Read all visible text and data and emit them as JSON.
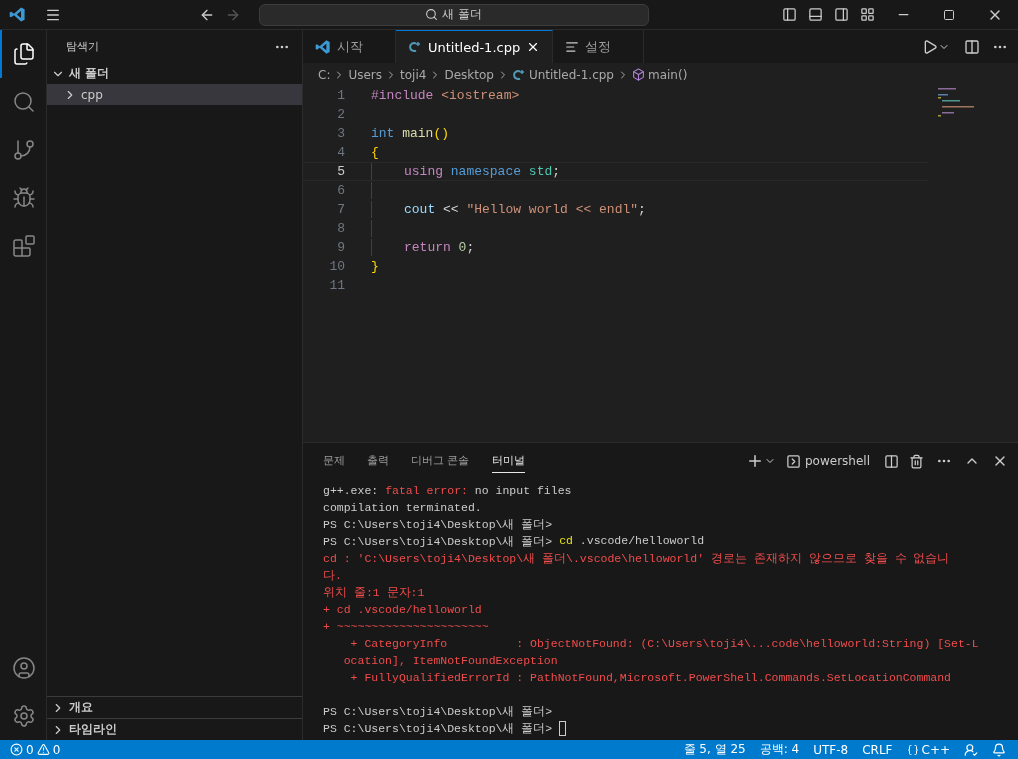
{
  "title_bar": {
    "search": "새 폴더"
  },
  "sidebar": {
    "title": "탐색기",
    "folder": {
      "label": "새 폴더",
      "expanded": true,
      "children": [
        {
          "label": "cpp",
          "expanded": false,
          "selected": true
        }
      ]
    },
    "sections": [
      {
        "label": "개요",
        "expanded": false
      },
      {
        "label": "타임라인",
        "expanded": false
      }
    ]
  },
  "tabs": [
    {
      "label": "시작",
      "kind": "welcome",
      "selected": false
    },
    {
      "label": "Untitled-1.cpp",
      "kind": "cpp",
      "selected": true
    },
    {
      "label": "설정",
      "kind": "settings",
      "selected": false
    }
  ],
  "breadcrumb": [
    {
      "label": "C:",
      "kind": "folder"
    },
    {
      "label": "Users",
      "kind": "folder"
    },
    {
      "label": "toji4",
      "kind": "folder"
    },
    {
      "label": "Desktop",
      "kind": "folder"
    },
    {
      "label": "Untitled-1.cpp",
      "kind": "file"
    },
    {
      "label": "main()",
      "kind": "symbol"
    }
  ],
  "editor": {
    "lines": [
      {
        "number": "1",
        "current": false,
        "indented": false,
        "tokens": [
          {
            "kind": "directive",
            "text": "#include"
          },
          {
            "kind": "string",
            "text": " <iostream>"
          }
        ]
      },
      {
        "number": "2",
        "current": false,
        "indented": false
      },
      {
        "number": "3",
        "current": false,
        "indented": false,
        "tokens": [
          {
            "kind": "type",
            "text": "int"
          },
          {
            "kind": "function",
            "text": " main"
          },
          {
            "kind": "bracket",
            "text": "()"
          }
        ]
      },
      {
        "number": "4",
        "current": false,
        "indented": false,
        "tokens": [
          {
            "kind": "bracket",
            "text": "{"
          }
        ]
      },
      {
        "number": "5",
        "current": true,
        "indented": true,
        "tokens": [
          {
            "kind": "control",
            "text": "using"
          },
          {
            "kind": "type",
            "text": " namespace"
          },
          {
            "kind": "class",
            "text": " std"
          },
          {
            "kind": "plain",
            "text": ";"
          }
        ]
      },
      {
        "number": "6",
        "current": false,
        "indented": true
      },
      {
        "number": "7",
        "current": false,
        "indented": true,
        "tokens": [
          {
            "kind": "variable",
            "text": "cout"
          },
          {
            "kind": "plain",
            "text": " << "
          },
          {
            "kind": "string",
            "text": "\"Hellow world << endl\""
          },
          {
            "kind": "plain",
            "text": ";"
          }
        ]
      },
      {
        "number": "8",
        "current": false,
        "indented": true
      },
      {
        "number": "9",
        "current": false,
        "indented": true,
        "tokens": [
          {
            "kind": "control",
            "text": "return"
          },
          {
            "kind": "number",
            "text": " 0"
          },
          {
            "kind": "plain",
            "text": ";"
          }
        ]
      },
      {
        "number": "10",
        "current": false,
        "indented": false,
        "tokens": [
          {
            "kind": "bracket",
            "text": "}"
          }
        ]
      },
      {
        "number": "11",
        "current": false,
        "indented": false
      }
    ]
  },
  "panel": {
    "tabs": [
      {
        "label": "문제",
        "selected": false
      },
      {
        "label": "출력",
        "selected": false
      },
      {
        "label": "디버그 콘솔",
        "selected": false
      },
      {
        "label": "터미널",
        "selected": true
      }
    ],
    "terminal_name": "powershell",
    "cursor": true,
    "lines": [
      {
        "segments": [
          {
            "kind": "plain",
            "text": "g++.exe: "
          },
          {
            "kind": "error",
            "text": "fatal error:"
          },
          {
            "kind": "plain",
            "text": " no input files"
          }
        ]
      },
      {
        "segments": [
          {
            "kind": "plain",
            "text": "compilation terminated."
          }
        ]
      },
      {
        "segments": [
          {
            "kind": "plain",
            "text": "PS C:\\Users\\toji4\\Desktop\\새 폴더>"
          }
        ]
      },
      {
        "segments": [
          {
            "kind": "plain",
            "text": "PS C:\\Users\\toji4\\Desktop\\새 폴더> "
          },
          {
            "kind": "command",
            "text": "cd"
          },
          {
            "kind": "plain",
            "text": " .vscode/helloworld"
          }
        ]
      },
      {
        "segments": [
          {
            "kind": "error",
            "text": "cd : 'C:\\Users\\toji4\\Desktop\\새 폴더\\.vscode\\helloworld' 경로는 존재하지 않으므로 찾을 수 없습니"
          }
        ]
      },
      {
        "segments": [
          {
            "kind": "error",
            "text": "다."
          }
        ]
      },
      {
        "segments": [
          {
            "kind": "error",
            "text": "위치 줄:1 문자:1"
          }
        ]
      },
      {
        "segments": [
          {
            "kind": "error",
            "text": "+ cd .vscode/helloworld"
          }
        ]
      },
      {
        "segments": [
          {
            "kind": "error",
            "text": "+ ~~~~~~~~~~~~~~~~~~~~~~"
          }
        ]
      },
      {
        "segments": [
          {
            "kind": "error",
            "text": "    + CategoryInfo          : ObjectNotFound: (C:\\Users\\toji4\\...code\\helloworld:String) [Set-L"
          }
        ]
      },
      {
        "segments": [
          {
            "kind": "error",
            "text": "   ocation], ItemNotFoundException"
          }
        ]
      },
      {
        "segments": [
          {
            "kind": "error",
            "text": "    + FullyQualifiedErrorId : PathNotFound,Microsoft.PowerShell.Commands.SetLocationCommand"
          }
        ]
      },
      {
        "blank": true
      },
      {
        "segments": [
          {
            "kind": "plain",
            "text": "PS C:\\Users\\toji4\\Desktop\\새 폴더>"
          }
        ]
      },
      {
        "segments": [
          {
            "kind": "plain",
            "text": "PS C:\\Users\\toji4\\Desktop\\새 폴더> "
          }
        ]
      }
    ]
  },
  "status_bar": {
    "errors": "0",
    "warnings": "0",
    "items": [
      "줄 5, 열 25",
      "공백: 4",
      "UTF-8",
      "CRLF"
    ],
    "language": "C++"
  }
}
